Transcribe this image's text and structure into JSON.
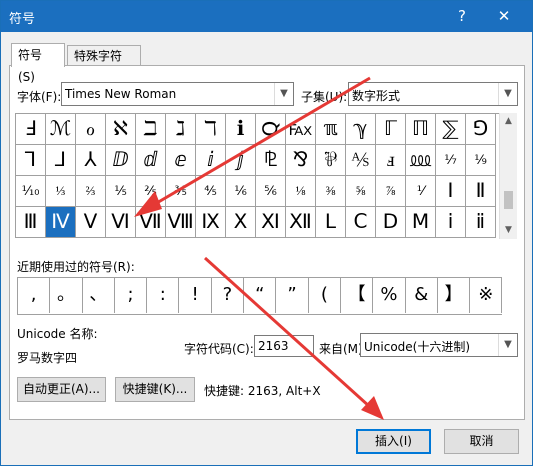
{
  "dialog": {
    "title": "符号",
    "help_glyph": "?",
    "close_glyph": "✕"
  },
  "tabs": [
    {
      "label": "符号(S)"
    },
    {
      "label": "特殊字符(P)"
    }
  ],
  "font": {
    "label": "字体(F):",
    "value": "Times New Roman"
  },
  "subset": {
    "label": "子集(U):",
    "value": "数字形式"
  },
  "grid": {
    "rows": [
      [
        "Ⅎ",
        "ℳ",
        "ℴ",
        "ℵ",
        "ℶ",
        "ℷ",
        "ℸ",
        "ℹ",
        "℺",
        "℻",
        "ℼ",
        "ℽ",
        "ℾ",
        "ℿ",
        "⅀",
        "⅁"
      ],
      [
        "⅂",
        "⅃",
        "⅄",
        "ⅅ",
        "ⅆ",
        "ⅇ",
        "ⅈ",
        "ⅉ",
        "⅊",
        "⅋",
        "⅌",
        "⅍",
        "ⅎ",
        "⅏",
        "⅐",
        "⅑"
      ],
      [
        "⅒",
        "⅓",
        "⅔",
        "⅕",
        "⅖",
        "⅗",
        "⅘",
        "⅙",
        "⅚",
        "⅛",
        "⅜",
        "⅝",
        "⅞",
        "⅟",
        "Ⅰ",
        "Ⅱ"
      ],
      [
        "Ⅲ",
        "Ⅳ",
        "Ⅴ",
        "Ⅵ",
        "Ⅶ",
        "Ⅷ",
        "Ⅸ",
        "Ⅹ",
        "Ⅺ",
        "Ⅻ",
        "Ⅼ",
        "Ⅽ",
        "Ⅾ",
        "Ⅿ",
        "ⅰ",
        "ⅱ"
      ]
    ],
    "selected": {
      "row": 3,
      "col": 1
    }
  },
  "recent": {
    "label": "近期使用过的符号(R):",
    "symbols": [
      ",",
      "。",
      "、",
      ";",
      ":",
      "!",
      "?",
      "“",
      "”",
      "(",
      "【",
      "%",
      "&",
      "】",
      "※"
    ]
  },
  "unicode": {
    "name_label": "Unicode 名称:",
    "name_value": "罗马数字四"
  },
  "charcode": {
    "label": "字符代码(C):",
    "value": "2163"
  },
  "from": {
    "label": "来自(M):",
    "value": "Unicode(十六进制)"
  },
  "buttons": {
    "autocorrect": "自动更正(A)...",
    "shortcut_key": "快捷键(K)...",
    "shortcut_info": "快捷键: 2163, Alt+X",
    "insert": "插入(I)",
    "cancel": "取消"
  },
  "colors": {
    "titlebar": "#1b6fbf",
    "selection": "#1b6fbf",
    "annotation": "#e53935"
  }
}
